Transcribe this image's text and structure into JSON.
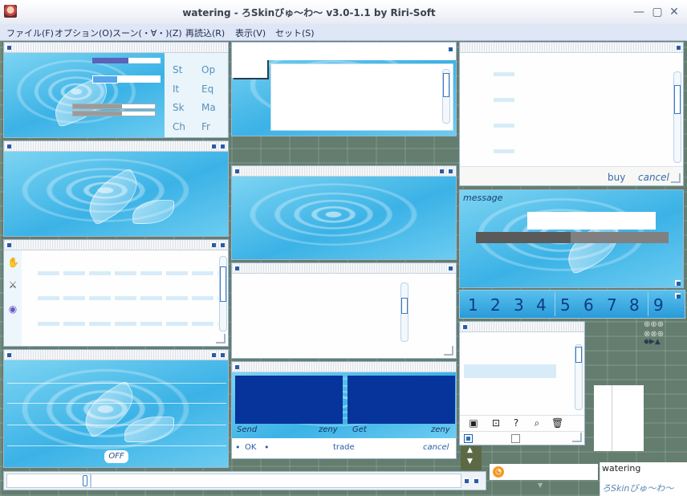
{
  "window": {
    "title": "watering - ろSkinびゅ〜わ〜 v3.0-1.1 by Riri-Soft",
    "minimize": "—",
    "maximize": "▢",
    "close": "✕"
  },
  "menu": [
    {
      "label": "ファイル(F)"
    },
    {
      "label": "オプション(O)"
    },
    {
      "label": "スーン(・∀・)(Z)"
    },
    {
      "label": "再読込(R)"
    },
    {
      "label": "表示(V)"
    },
    {
      "label": "セット(S)"
    }
  ],
  "status_panel": {
    "stats_left": [
      "St",
      "It",
      "Sk",
      "Ch"
    ],
    "stats_right": [
      "Op",
      "Eq",
      "Ma",
      "Fr"
    ]
  },
  "shop_panel": {
    "buy_label": "buy",
    "cancel_label": "cancel"
  },
  "chat_panel": {
    "message_label": "message",
    "hp_fraction": 0.49
  },
  "hotbar": {
    "numbers": [
      "1",
      "2",
      "3",
      "4",
      "5",
      "6",
      "7",
      "8",
      "9"
    ]
  },
  "left_bottom_panel": {
    "off_label": "OFF"
  },
  "trade_panel": {
    "send_label": "Send",
    "get_label": "Get",
    "zeny_left": "zeny",
    "zeny_right": "zeny",
    "ok_label": "OK",
    "trade_label": "trade",
    "cancel_label": "cancel"
  },
  "minimap": {
    "name_label": "watering",
    "skin_label": "ろSkinびゅ〜わ〜"
  },
  "colors": {
    "accent": "#2a5ca6",
    "trade_tile": "#06349a",
    "water": "#3bb2e6"
  }
}
